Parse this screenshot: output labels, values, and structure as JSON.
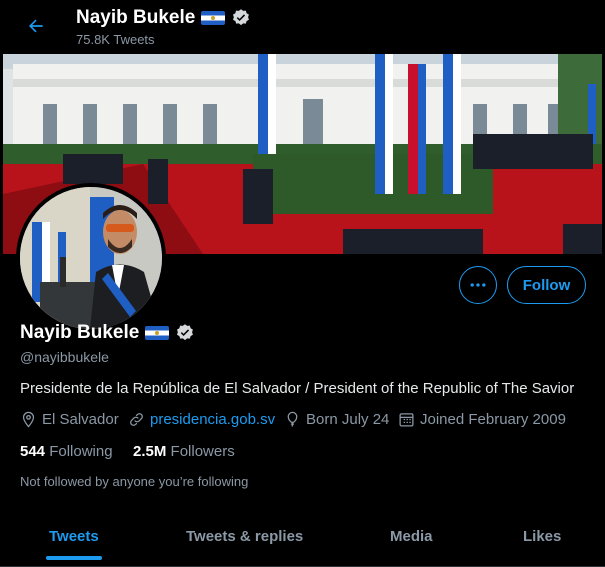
{
  "colors": {
    "accent": "#1d9bf0",
    "background": "#000000",
    "text": "#e7e9ea",
    "muted": "#8b98a5"
  },
  "header": {
    "name": "Nayib Bukele",
    "tweet_count": "75.8K Tweets",
    "flag_icon": "el-salvador-flag",
    "verified_icon": "verified-badge"
  },
  "banner": {
    "description_icon": "photo"
  },
  "actions": {
    "more_icon": "more-horizontal",
    "follow_label": "Follow"
  },
  "profile": {
    "name": "Nayib Bukele",
    "handle": "@nayibbukele",
    "bio": "Presidente de la República de El Salvador / President of the Republic of The Savior",
    "location": "El Salvador",
    "website": "presidencia.gob.sv",
    "birthday": "Born July 24",
    "joined": "Joined February 2009",
    "following_count": "544",
    "following_label": "Following",
    "followers_count": "2.5M",
    "followers_label": "Followers",
    "followed_by": "Not followed by anyone you’re following"
  },
  "tabs": [
    {
      "label": "Tweets",
      "active": true
    },
    {
      "label": "Tweets & replies",
      "active": false
    },
    {
      "label": "Media",
      "active": false
    },
    {
      "label": "Likes",
      "active": false
    }
  ]
}
